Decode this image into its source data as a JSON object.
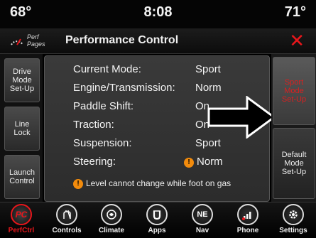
{
  "status": {
    "temp_left": "68°",
    "clock": "8:08",
    "temp_right": "71°"
  },
  "header": {
    "perf_pages_line1": "Perf",
    "perf_pages_line2": "Pages",
    "title": "Performance Control",
    "close_icon": "close-x-icon",
    "accent": "#e8161b"
  },
  "left_rail": [
    {
      "label_lines": [
        "Drive",
        "Mode",
        "Set-Up"
      ]
    },
    {
      "label_lines": [
        "Line",
        "Lock"
      ]
    },
    {
      "label_lines": [
        "Launch",
        "Control"
      ]
    }
  ],
  "rows": [
    {
      "label": "Current Mode:",
      "value": "Sport"
    },
    {
      "label": "Engine/Transmission:",
      "value": "Norm"
    },
    {
      "label": "Paddle Shift:",
      "value": "On"
    },
    {
      "label": "Traction:",
      "value": "On"
    },
    {
      "label": "Suspension:",
      "value": "Sport"
    },
    {
      "label": "Steering:",
      "value": "Norm"
    }
  ],
  "warning": "Level cannot change while foot on gas",
  "right_rail": [
    {
      "label_lines": [
        "Sport",
        "Mode",
        "Set-Up"
      ],
      "active": true
    },
    {
      "label_lines": [
        "Default",
        "Mode",
        "Set-Up"
      ],
      "active": false
    }
  ],
  "nav": [
    {
      "label": "PerfCtrl",
      "icon": "pc",
      "active": true
    },
    {
      "label": "Controls",
      "icon": "controls",
      "active": false
    },
    {
      "label": "Climate",
      "icon": "climate",
      "active": false
    },
    {
      "label": "Apps",
      "icon": "apps",
      "active": false
    },
    {
      "label": "Nav",
      "icon": "nav",
      "active": false
    },
    {
      "label": "Phone",
      "icon": "phone",
      "active": false
    },
    {
      "label": "Settings",
      "icon": "settings",
      "active": false
    }
  ]
}
